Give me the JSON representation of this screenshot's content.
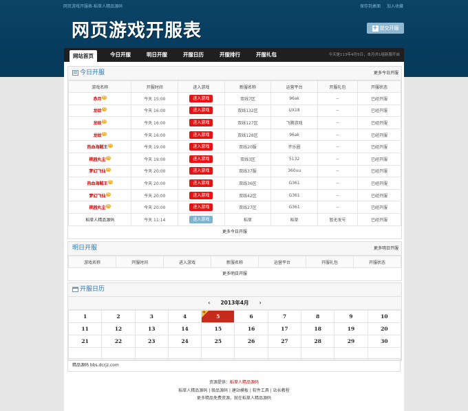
{
  "topbar": {
    "left_link": "网页游戏开服表-稻草人精品源码",
    "right_links": [
      "保存到桌面",
      "加入收藏"
    ]
  },
  "logo": "网页游戏开服表",
  "submit_button": "提交开服",
  "nav": {
    "items": [
      "网站首页",
      "今日开服",
      "明日开服",
      "开服日历",
      "开服排行",
      "开服礼包"
    ],
    "note": "今天是113年4月5日，本月共1组新服开启"
  },
  "today": {
    "title": "今日开服",
    "more": "更多今日开服",
    "columns": [
      "游戏名称",
      "开服时间",
      "进入游戏",
      "新服名称",
      "运营平台",
      "开服礼包",
      "开服状态"
    ],
    "rows": [
      {
        "name": "赤月",
        "badge": "礼",
        "time": "今天 15:00",
        "btn": "进入游戏",
        "server": "双线7区",
        "platform": "96ak",
        "gift": "--",
        "status": "已经开服",
        "plain": false
      },
      {
        "name": "龙纹",
        "badge": "礼",
        "time": "今天 16:00",
        "btn": "进入游戏",
        "server": "双线132区",
        "platform": "UX18",
        "gift": "--",
        "status": "已经开服",
        "plain": false
      },
      {
        "name": "龙纹",
        "badge": "礼",
        "time": "今天 16:00",
        "btn": "进入游戏",
        "server": "双线127区",
        "platform": "飞腾游戏",
        "gift": "--",
        "status": "已经开服",
        "plain": false
      },
      {
        "name": "龙纹",
        "badge": "礼",
        "time": "今天 16:00",
        "btn": "进入游戏",
        "server": "双线128区",
        "platform": "96ak",
        "gift": "--",
        "status": "已经开服",
        "plain": false
      },
      {
        "name": "热血海贼王",
        "badge": "礼",
        "time": "今天 19:00",
        "btn": "进入游戏",
        "server": "双线20服",
        "platform": "齐乐圈",
        "gift": "--",
        "status": "已经开服",
        "plain": false
      },
      {
        "name": "桃园丸尘",
        "badge": "礼",
        "time": "今天 19:00",
        "btn": "进入游戏",
        "server": "双线3区",
        "platform": "5132",
        "gift": "--",
        "status": "已经开服",
        "plain": false
      },
      {
        "name": "梦幻飞仙",
        "badge": "礼",
        "time": "今天 20:00",
        "btn": "进入游戏",
        "server": "双线37服",
        "platform": "360uu",
        "gift": "--",
        "status": "已经开服",
        "plain": false
      },
      {
        "name": "热血海贼王",
        "badge": "礼",
        "time": "今天 20:00",
        "btn": "进入游戏",
        "server": "双线36区",
        "platform": "G361",
        "gift": "--",
        "status": "已经开服",
        "plain": false
      },
      {
        "name": "梦幻飞仙",
        "badge": "礼",
        "time": "今天 20:00",
        "btn": "进入游戏",
        "server": "双线42区",
        "platform": "G361",
        "gift": "--",
        "status": "已经开服",
        "plain": false
      },
      {
        "name": "桃园丸尘",
        "badge": "礼",
        "time": "今天 20:00",
        "btn": "进入游戏",
        "server": "双线27区",
        "platform": "G361",
        "gift": "--",
        "status": "已经开服",
        "plain": false
      },
      {
        "name": "稻草人精品源码",
        "badge": "",
        "time": "今天 11:14",
        "btn": "进入游戏",
        "server": "稻草",
        "platform": "稻草",
        "gift": "暂无发号",
        "status": "已经开服",
        "plain": true
      }
    ],
    "more_row": "更多今日开服"
  },
  "tomorrow": {
    "title": "明日开服",
    "more": "更多明日开服",
    "columns": [
      "游戏名称",
      "开服时间",
      "进入游戏",
      "新服名称",
      "运营平台",
      "开服礼包",
      "开服状态"
    ],
    "more_row": "更多明日开服"
  },
  "calendar": {
    "title": "开服日历",
    "month": "2013年4月",
    "prev": "‹",
    "next": "›",
    "today": "5",
    "today_mark": "今",
    "weeks": [
      [
        "1",
        "2",
        "3",
        "4",
        "5",
        "6",
        "7",
        "8",
        "9",
        "10"
      ],
      [
        "11",
        "12",
        "13",
        "14",
        "15",
        "16",
        "17",
        "18",
        "19",
        "20"
      ],
      [
        "21",
        "22",
        "23",
        "24",
        "25",
        "26",
        "27",
        "28",
        "29",
        "30"
      ],
      [
        "",
        "",
        "",
        "",
        "",
        "",
        "",
        "",
        "",
        ""
      ]
    ]
  },
  "links_box": "精品源码 bbs.dcrjz.com",
  "footer": {
    "line1_prefix": "资源提供：",
    "line1_link": "稻草人精品源码",
    "line2": [
      "稻草人精品源码",
      "极品源码",
      "建站模板",
      "软件工具",
      "站长教程"
    ],
    "line3": "更多精品免费资源，就在稻草人精品源码"
  },
  "colors": {
    "header_bg": "#073b5b",
    "accent_blue": "#2b78b5",
    "enter_red": "#e31414",
    "status_green": "#3aa535"
  }
}
